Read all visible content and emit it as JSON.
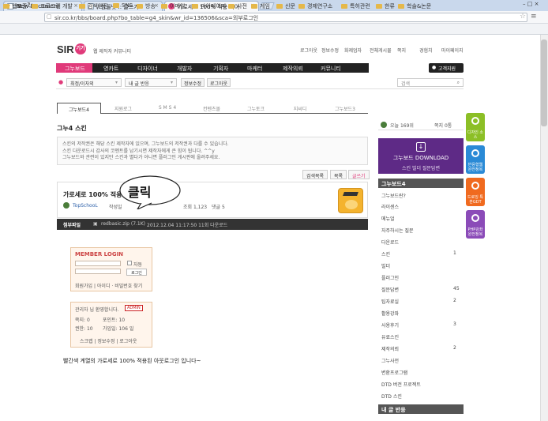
{
  "browser": {
    "tabs": [
      {
        "title": "New Document"
      },
      {
        "title": "/-한올넷 :: 글쓰기"
      },
      {
        "title": "가로세로 100% 적용 아이"
      }
    ],
    "url": "sir.co.kr/bbs/board.php?bo_table=g4_skin&wr_id=136506&sca=외부로그인",
    "bookmarks": [
      "웹표준",
      "프로그램 개발",
      "검색엔진",
      "SNS",
      "방송",
      "이메일",
      "마이페이지",
      "사전",
      "게임",
      "신문",
      "경제연구소",
      "특허관련",
      "한류",
      "학술&논문"
    ]
  },
  "site": {
    "logo_text": "SIR",
    "logo_mark": "기기",
    "tagline": "웹 제작자 커뮤니티",
    "top_links": [
      "로그아웃",
      "정보수정",
      "화제업자",
      "전체게시물",
      "쪽지",
      "경험치",
      "마이페이지"
    ],
    "nav": [
      "그누보드",
      "영카트",
      "디자이너",
      "개발자",
      "기획자",
      "마케터",
      "제작의뢰",
      "커뮤니티"
    ],
    "support_label": "고객지원",
    "select_profile": "최정/이자외",
    "select_menu": "내 글 반응",
    "btn_info": "정보수정",
    "btn_logout": "로그아웃",
    "search_placeholder": "검색"
  },
  "board": {
    "tabs": [
      "그누보드4",
      "지원로그",
      "S M S 4",
      "컨텐츠몰",
      "그누토크",
      "지씨디",
      "그누보드3"
    ],
    "title": "그누4 스킨",
    "notice_lines": [
      "스킨의 저작권은 해당 스킨 제작자에 있으며, 그누보드의 저작권과 다를 수 있습니다.",
      "스킨 다운로드시 감사의 코멘트를 남기시면 제작자에게 큰 힘이 됩니다. ^^y",
      "그누보드와 관련이 있지만 스킨과 별다가 아니면 플러그인 게시판에 올려주세요."
    ],
    "btn_search": "검색목록",
    "btn_list": "목록",
    "btn_write": "글쓰기"
  },
  "post": {
    "title": "가로세로 100% 적용",
    "author": "TopSchooL",
    "date_label": "작성일",
    "views": "조회 1,123",
    "comments": "댓글 5",
    "bubble_text": "클릭",
    "attach_label": "첨부파일",
    "attach_file": "redbasic.zip (7.1K)",
    "attach_info": "2012.12.04 11:17:50  11회 다운로드"
  },
  "login_widget": {
    "title": "MEMBER LOGIN",
    "auto_label": "자동",
    "login_btn": "로그인",
    "links": "회원가입 | 아이디 · 비밀번호 찾기"
  },
  "admin_widget": {
    "greeting": "관리자 님 환영합니다.",
    "badge": "ADMIN",
    "stat1": "쪽지: 0",
    "stat2": "포인트: 10",
    "stat3": "권한: 10",
    "stat4": "가입일: 106 일",
    "links": "스크랩 | 정보수정 | 로그아웃"
  },
  "body_text": "빨간색 계열의 가로세로 100% 적용된 아웃로그인 입니다~",
  "sidebar": {
    "today": "오늘 169위",
    "memo": "쪽지 0통",
    "download_title": "그누보드 DOWNLOAD",
    "download_links": "스킨  빌더  질문답변",
    "heading": "그누보드4",
    "items": [
      {
        "label": "그누보드란?",
        "count": ""
      },
      {
        "label": "라이센스",
        "count": ""
      },
      {
        "label": "메뉴얼",
        "count": ""
      },
      {
        "label": "자주하시는 질문",
        "count": ""
      },
      {
        "label": "다운로드",
        "count": ""
      },
      {
        "label": "스킨",
        "count": "1"
      },
      {
        "label": "빌더",
        "count": ""
      },
      {
        "label": "플러그인",
        "count": ""
      },
      {
        "label": "질문답변",
        "count": "45"
      },
      {
        "label": "팁자료실",
        "count": "2"
      },
      {
        "label": "활용강좌",
        "count": ""
      },
      {
        "label": "사용후기",
        "count": "3"
      },
      {
        "label": "유료스킨",
        "count": ""
      },
      {
        "label": "제작의뢰",
        "count": "2"
      },
      {
        "label": "그누사전",
        "count": ""
      },
      {
        "label": "변환프로그램",
        "count": ""
      },
      {
        "label": "DTD 버전 프로젝트",
        "count": ""
      },
      {
        "label": "DTD 스킨",
        "count": ""
      }
    ],
    "heading2": "내 글 반응"
  },
  "side_buttons": [
    {
      "label": "디자인 소스",
      "color": "#8cbf26"
    },
    {
      "label": "반응형웹 완전정복",
      "color": "#2a8ad6"
    },
    {
      "label": "드로잉 특훈GDT",
      "color": "#f06a1f"
    },
    {
      "label": "PHP강좌 완전정복",
      "color": "#8b4bb8"
    }
  ]
}
